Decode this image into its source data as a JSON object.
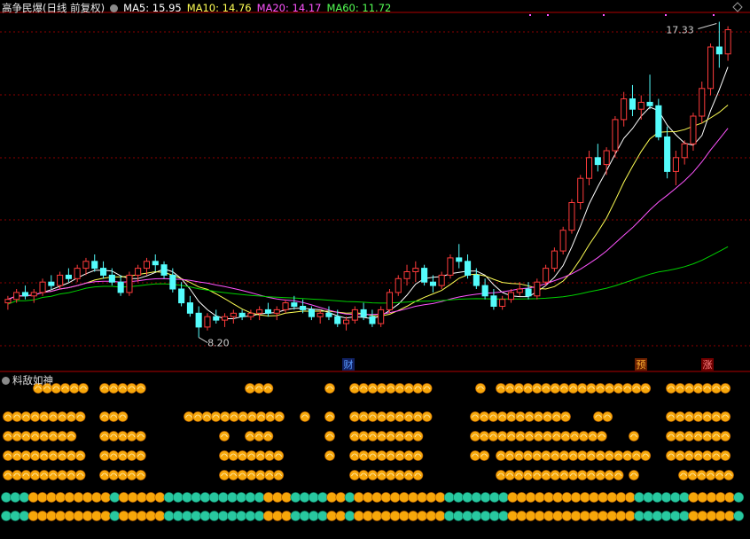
{
  "header": {
    "stock_name": "高争民爆(日线 前复权)",
    "ma5": "MA5: 15.95",
    "ma10": "MA10: 14.76",
    "ma20": "MA20: 14.17",
    "ma60": "MA60: 11.72"
  },
  "colors": {
    "up": "#ff3b3b",
    "down": "#54fcfc",
    "ma5": "#ffffff",
    "ma10": "#ffff54",
    "ma20": "#ff54ff",
    "ma60": "#00d000",
    "ma5_label": "#ffffff",
    "ma10_label": "#ffff54",
    "ma20_label": "#ff54ff",
    "ma60_label": "#54ff54",
    "grid": "#8b0000",
    "token_gold": "#f7a70a",
    "token_teal": "#28c8a0"
  },
  "subpanel": {
    "title": "料敌如神"
  },
  "chart_data": {
    "type": "candlestick",
    "max_label": "17.33",
    "min_label": "8.20",
    "markers": [
      "财",
      "预",
      "涨"
    ],
    "ylim": [
      7.6,
      17.6
    ],
    "candles": [
      [
        9.2,
        9.4,
        9.0,
        9.3
      ],
      [
        9.3,
        9.6,
        9.2,
        9.5
      ],
      [
        9.5,
        9.7,
        9.3,
        9.4
      ],
      [
        9.4,
        9.6,
        9.2,
        9.5
      ],
      [
        9.5,
        9.9,
        9.4,
        9.8
      ],
      [
        9.8,
        10.0,
        9.6,
        9.7
      ],
      [
        9.7,
        10.1,
        9.6,
        10.0
      ],
      [
        10.0,
        10.2,
        9.8,
        9.9
      ],
      [
        9.9,
        10.3,
        9.8,
        10.2
      ],
      [
        10.2,
        10.5,
        10.0,
        10.4
      ],
      [
        10.4,
        10.6,
        10.1,
        10.2
      ],
      [
        10.2,
        10.4,
        9.9,
        10.0
      ],
      [
        10.0,
        10.2,
        9.7,
        9.8
      ],
      [
        9.8,
        10.0,
        9.4,
        9.5
      ],
      [
        9.5,
        10.1,
        9.4,
        10.0
      ],
      [
        10.0,
        10.3,
        9.8,
        10.2
      ],
      [
        10.2,
        10.5,
        10.0,
        10.4
      ],
      [
        10.4,
        10.6,
        10.1,
        10.3
      ],
      [
        10.3,
        10.4,
        9.9,
        10.0
      ],
      [
        10.0,
        10.2,
        9.5,
        9.6
      ],
      [
        9.6,
        9.8,
        9.1,
        9.2
      ],
      [
        9.2,
        9.4,
        8.8,
        8.9
      ],
      [
        8.9,
        9.1,
        8.2,
        8.5
      ],
      [
        8.5,
        8.9,
        8.4,
        8.8
      ],
      [
        8.8,
        9.0,
        8.6,
        8.7
      ],
      [
        8.7,
        8.9,
        8.5,
        8.8
      ],
      [
        8.8,
        9.0,
        8.6,
        8.9
      ],
      [
        8.9,
        9.0,
        8.7,
        8.8
      ],
      [
        8.8,
        9.0,
        8.7,
        8.9
      ],
      [
        8.9,
        9.1,
        8.7,
        9.0
      ],
      [
        9.0,
        9.2,
        8.8,
        8.9
      ],
      [
        8.9,
        9.1,
        8.7,
        9.0
      ],
      [
        9.0,
        9.3,
        8.9,
        9.2
      ],
      [
        9.2,
        9.4,
        9.0,
        9.1
      ],
      [
        9.1,
        9.3,
        8.9,
        9.0
      ],
      [
        9.0,
        9.1,
        8.7,
        8.8
      ],
      [
        8.8,
        9.0,
        8.6,
        8.9
      ],
      [
        8.9,
        9.1,
        8.7,
        8.8
      ],
      [
        8.8,
        9.0,
        8.5,
        8.6
      ],
      [
        8.6,
        8.8,
        8.4,
        8.7
      ],
      [
        8.7,
        9.1,
        8.6,
        9.0
      ],
      [
        9.0,
        9.2,
        8.7,
        8.8
      ],
      [
        8.8,
        9.0,
        8.5,
        8.6
      ],
      [
        8.6,
        9.1,
        8.5,
        9.0
      ],
      [
        9.0,
        9.6,
        8.9,
        9.5
      ],
      [
        9.5,
        10.0,
        9.4,
        9.9
      ],
      [
        9.9,
        10.3,
        9.7,
        10.1
      ],
      [
        10.1,
        10.4,
        9.8,
        10.2
      ],
      [
        10.2,
        10.3,
        9.7,
        9.8
      ],
      [
        9.8,
        10.0,
        9.5,
        9.7
      ],
      [
        9.7,
        10.1,
        9.6,
        10.0
      ],
      [
        10.0,
        10.6,
        9.9,
        10.5
      ],
      [
        10.5,
        10.9,
        10.2,
        10.4
      ],
      [
        10.4,
        10.6,
        9.9,
        10.0
      ],
      [
        10.0,
        10.2,
        9.6,
        9.7
      ],
      [
        9.7,
        9.9,
        9.3,
        9.4
      ],
      [
        9.4,
        9.6,
        9.0,
        9.1
      ],
      [
        9.1,
        9.4,
        9.0,
        9.3
      ],
      [
        9.3,
        9.6,
        9.2,
        9.5
      ],
      [
        9.5,
        9.8,
        9.4,
        9.6
      ],
      [
        9.6,
        9.8,
        9.3,
        9.4
      ],
      [
        9.4,
        9.9,
        9.3,
        9.8
      ],
      [
        9.8,
        10.3,
        9.7,
        10.2
      ],
      [
        10.2,
        10.8,
        10.1,
        10.7
      ],
      [
        10.7,
        11.4,
        10.6,
        11.3
      ],
      [
        11.3,
        12.2,
        11.2,
        12.1
      ],
      [
        12.1,
        12.9,
        11.9,
        12.8
      ],
      [
        12.8,
        13.6,
        12.6,
        13.4
      ],
      [
        13.4,
        13.8,
        13.0,
        13.2
      ],
      [
        13.2,
        13.7,
        12.9,
        13.6
      ],
      [
        13.6,
        14.6,
        13.4,
        14.5
      ],
      [
        14.5,
        15.3,
        14.3,
        15.1
      ],
      [
        15.1,
        15.5,
        14.6,
        14.8
      ],
      [
        14.8,
        15.2,
        14.5,
        15.0
      ],
      [
        15.0,
        15.8,
        14.8,
        14.9
      ],
      [
        14.9,
        15.1,
        13.9,
        14.0
      ],
      [
        14.0,
        14.3,
        12.8,
        13.0
      ],
      [
        13.0,
        13.6,
        12.6,
        13.4
      ],
      [
        13.4,
        13.9,
        13.2,
        13.8
      ],
      [
        13.8,
        14.7,
        13.6,
        14.6
      ],
      [
        14.6,
        15.6,
        14.4,
        15.4
      ],
      [
        15.4,
        16.7,
        15.2,
        16.6
      ],
      [
        16.6,
        17.33,
        16.0,
        16.4
      ],
      [
        16.4,
        17.2,
        16.2,
        17.1
      ]
    ]
  }
}
